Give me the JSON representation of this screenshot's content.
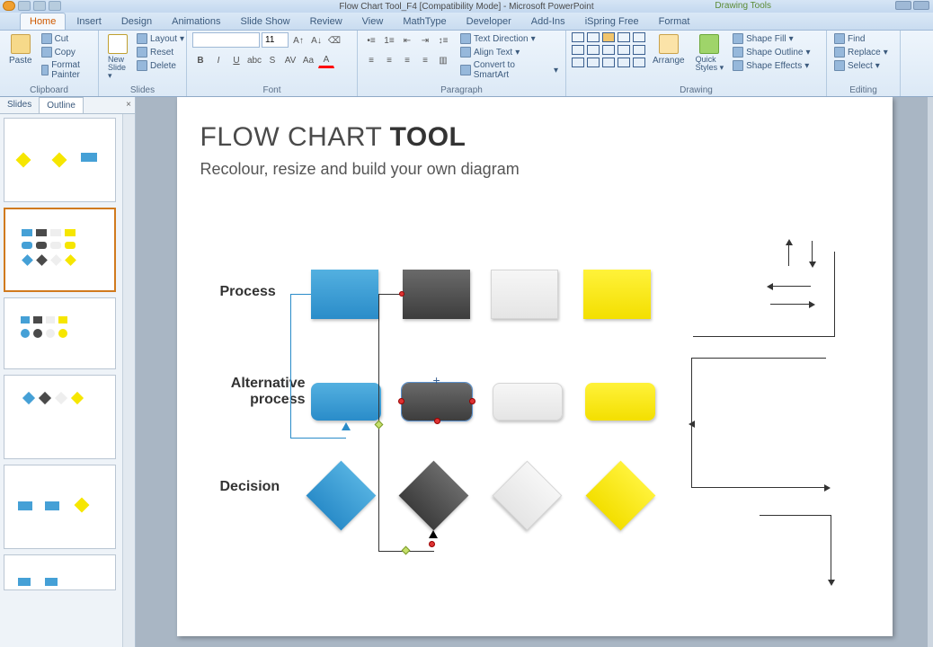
{
  "titlebar": {
    "title": "Flow Chart Tool_F4 [Compatibility Mode] - Microsoft PowerPoint",
    "context_tool": "Drawing Tools"
  },
  "ribbon": {
    "tabs": [
      "Home",
      "Insert",
      "Design",
      "Animations",
      "Slide Show",
      "Review",
      "View",
      "MathType",
      "Developer",
      "Add-Ins",
      "iSpring Free",
      "Format"
    ],
    "active_tab": "Home",
    "groups": {
      "clipboard": {
        "label": "Clipboard",
        "paste": "Paste",
        "cut": "Cut",
        "copy": "Copy",
        "format_painter": "Format Painter"
      },
      "slides": {
        "label": "Slides",
        "new_slide": "New Slide",
        "layout": "Layout",
        "reset": "Reset",
        "delete": "Delete"
      },
      "font": {
        "label": "Font",
        "font_name": "",
        "font_size": "11"
      },
      "paragraph": {
        "label": "Paragraph",
        "text_direction": "Text Direction",
        "align_text": "Align Text",
        "convert_smartart": "Convert to SmartArt"
      },
      "drawing": {
        "label": "Drawing",
        "arrange": "Arrange",
        "quick_styles": "Quick Styles",
        "shape_fill": "Shape Fill",
        "shape_outline": "Shape Outline",
        "shape_effects": "Shape Effects"
      },
      "editing": {
        "label": "Editing",
        "find": "Find",
        "replace": "Replace",
        "select": "Select"
      }
    }
  },
  "slides_panel": {
    "tab_slides": "Slides",
    "tab_outline": "Outline",
    "selected_index": 1
  },
  "slide": {
    "title_prefix": "FLOW CHART ",
    "title_bold": "TOOL",
    "subtitle": "Recolour, resize and build your own diagram",
    "row_process": "Process",
    "row_altprocess": "Alternative process",
    "row_decision": "Decision"
  },
  "colors": {
    "blue": "#2a8cc9",
    "dark": "#4a4a4a",
    "light": "#ececec",
    "yellow": "#f6e600"
  }
}
